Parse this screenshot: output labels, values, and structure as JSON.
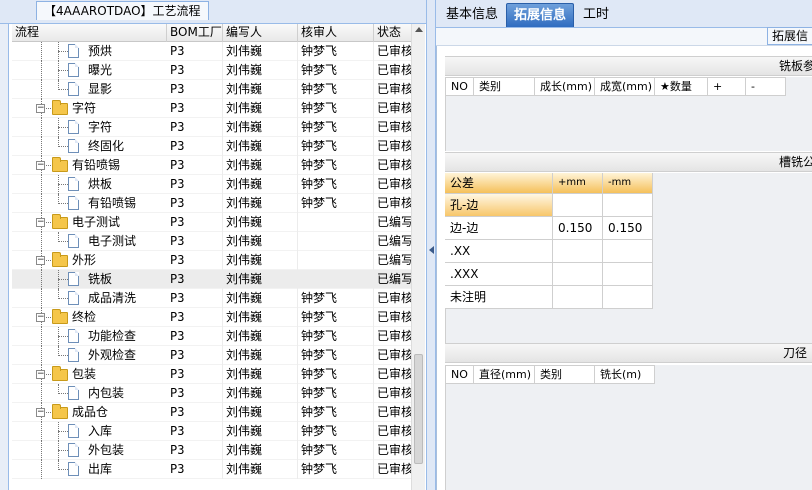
{
  "left_panel": {
    "tab_title": "【4AAAROTDAO】工艺流程",
    "columns": [
      "流程",
      "BOM工厂",
      "编写人",
      "核审人",
      "状态"
    ],
    "rows": [
      {
        "type": "leaf",
        "name": "预烘",
        "bom": "P3",
        "writer": "刘伟巍",
        "reviewer": "钟梦飞",
        "status": "已审核"
      },
      {
        "type": "leaf",
        "name": "曝光",
        "bom": "P3",
        "writer": "刘伟巍",
        "reviewer": "钟梦飞",
        "status": "已审核"
      },
      {
        "type": "leaf",
        "name": "显影",
        "bom": "P3",
        "writer": "刘伟巍",
        "reviewer": "钟梦飞",
        "status": "已审核"
      },
      {
        "type": "folder",
        "name": "字符",
        "bom": "P3",
        "writer": "刘伟巍",
        "reviewer": "钟梦飞",
        "status": "已审核"
      },
      {
        "type": "leaf",
        "name": "字符",
        "bom": "P3",
        "writer": "刘伟巍",
        "reviewer": "钟梦飞",
        "status": "已审核"
      },
      {
        "type": "leaf",
        "name": "终固化",
        "bom": "P3",
        "writer": "刘伟巍",
        "reviewer": "钟梦飞",
        "status": "已审核"
      },
      {
        "type": "folder",
        "name": "有铅喷锡",
        "bom": "P3",
        "writer": "刘伟巍",
        "reviewer": "钟梦飞",
        "status": "已审核"
      },
      {
        "type": "leaf",
        "name": "烘板",
        "bom": "P3",
        "writer": "刘伟巍",
        "reviewer": "钟梦飞",
        "status": "已审核"
      },
      {
        "type": "leaf",
        "name": "有铅喷锡",
        "bom": "P3",
        "writer": "刘伟巍",
        "reviewer": "钟梦飞",
        "status": "已审核"
      },
      {
        "type": "folder",
        "name": "电子测试",
        "bom": "P3",
        "writer": "刘伟巍",
        "reviewer": "",
        "status": "已编写"
      },
      {
        "type": "leaf",
        "name": "电子测试",
        "bom": "P3",
        "writer": "刘伟巍",
        "reviewer": "",
        "status": "已编写"
      },
      {
        "type": "folder",
        "name": "外形",
        "bom": "P3",
        "writer": "刘伟巍",
        "reviewer": "",
        "status": "已编写"
      },
      {
        "type": "leaf",
        "name": "铣板",
        "bom": "P3",
        "writer": "刘伟巍",
        "reviewer": "",
        "status": "已编写",
        "selected": true
      },
      {
        "type": "leaf",
        "name": "成品清洗",
        "bom": "P3",
        "writer": "刘伟巍",
        "reviewer": "钟梦飞",
        "status": "已审核"
      },
      {
        "type": "folder",
        "name": "终检",
        "bom": "P3",
        "writer": "刘伟巍",
        "reviewer": "钟梦飞",
        "status": "已审核"
      },
      {
        "type": "leaf",
        "name": "功能检查",
        "bom": "P3",
        "writer": "刘伟巍",
        "reviewer": "钟梦飞",
        "status": "已审核"
      },
      {
        "type": "leaf",
        "name": "外观检查",
        "bom": "P3",
        "writer": "刘伟巍",
        "reviewer": "钟梦飞",
        "status": "已审核"
      },
      {
        "type": "folder",
        "name": "包装",
        "bom": "P3",
        "writer": "刘伟巍",
        "reviewer": "钟梦飞",
        "status": "已审核"
      },
      {
        "type": "leaf",
        "name": "内包装",
        "bom": "P3",
        "writer": "刘伟巍",
        "reviewer": "钟梦飞",
        "status": "已审核"
      },
      {
        "type": "folder",
        "name": "成品仓",
        "bom": "P3",
        "writer": "刘伟巍",
        "reviewer": "钟梦飞",
        "status": "已审核"
      },
      {
        "type": "leaf",
        "name": "入库",
        "bom": "P3",
        "writer": "刘伟巍",
        "reviewer": "钟梦飞",
        "status": "已审核"
      },
      {
        "type": "leaf",
        "name": "外包装",
        "bom": "P3",
        "writer": "刘伟巍",
        "reviewer": "钟梦飞",
        "status": "已审核"
      },
      {
        "type": "leaf",
        "name": "出库",
        "bom": "P3",
        "writer": "刘伟巍",
        "reviewer": "钟梦飞",
        "status": "已审核"
      }
    ]
  },
  "right_panel": {
    "tabs": [
      "基本信息",
      "拓展信息",
      "工时"
    ],
    "active_tab": 1,
    "toolbar_button": "拓展信",
    "section1": {
      "title": "铣板参",
      "columns": [
        "NO",
        "类别",
        "成长(mm)",
        "成宽(mm)",
        "★数量",
        "+",
        "-"
      ]
    },
    "section2": {
      "title": "槽铣公",
      "header": [
        "公差",
        "+mm",
        "-mm"
      ],
      "rows": [
        [
          "孔-边",
          "",
          ""
        ],
        [
          "边-边",
          "0.150",
          "0.150"
        ],
        [
          ".XX",
          "",
          ""
        ],
        [
          ".XXX",
          "",
          ""
        ],
        [
          "未注明",
          "",
          ""
        ]
      ]
    },
    "section3": {
      "title": "刀径",
      "columns": [
        "NO",
        "直径(mm)",
        "类别",
        "铣长(m)"
      ]
    }
  }
}
